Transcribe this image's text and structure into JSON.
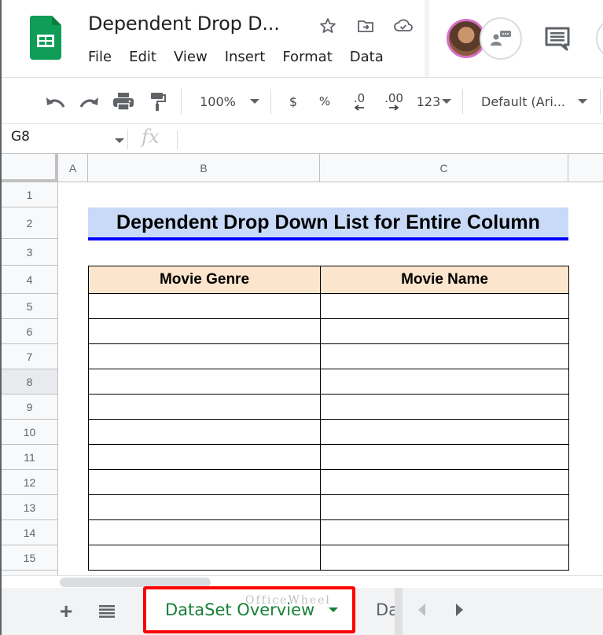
{
  "app": {
    "doc_title": "Dependent Drop D...",
    "brand_color": "#0f9d58"
  },
  "menu": [
    "File",
    "Edit",
    "View",
    "Insert",
    "Format",
    "Data"
  ],
  "title_icons": [
    "star-icon",
    "move-to-folder-icon",
    "cloud-saved-icon"
  ],
  "toolbar": {
    "zoom": "100%",
    "currency": "$",
    "percent": "%",
    "decrease_decimal": ".0",
    "increase_decimal": ".00",
    "more_formats": "123",
    "font": "Default (Ari..."
  },
  "formula_bar": {
    "name_box": "G8",
    "fx_label": "fx",
    "formula": ""
  },
  "columns": [
    "A",
    "B",
    "C"
  ],
  "rows": [
    "1",
    "2",
    "3",
    "4",
    "5",
    "6",
    "7",
    "8",
    "9",
    "10",
    "11",
    "12",
    "13",
    "14",
    "15"
  ],
  "selected_row": "8",
  "sheet": {
    "title": "Dependent Drop Down List for Entire Column",
    "table_headers": [
      "Movie Genre",
      "Movie Name"
    ],
    "table_rows": [
      [
        "",
        ""
      ],
      [
        "",
        ""
      ],
      [
        "",
        ""
      ],
      [
        "",
        ""
      ],
      [
        "",
        ""
      ],
      [
        "",
        ""
      ],
      [
        "",
        ""
      ],
      [
        "",
        ""
      ],
      [
        "",
        ""
      ],
      [
        "",
        ""
      ],
      [
        "",
        ""
      ]
    ],
    "colors": {
      "title_bg": "#c9daf8",
      "title_underline": "#0000ff",
      "header_bg": "#fce5cd"
    }
  },
  "bottom_bar": {
    "add_sheet": "+",
    "active_tab": "DataSet Overview",
    "next_tab": "Da",
    "watermark": "OfficeWheel",
    "highlight_color": "#ff0000"
  }
}
